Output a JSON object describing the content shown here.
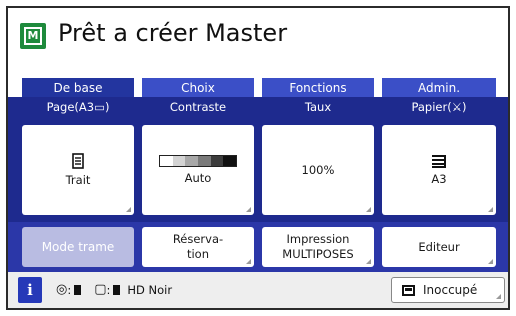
{
  "header": {
    "title": "Prêt a créer Master",
    "icon": "master-icon",
    "icon_letter": "M",
    "icon_color": "#1e8a3c"
  },
  "tabs": [
    {
      "label": "De base",
      "active": true
    },
    {
      "label": "Choix",
      "active": false
    },
    {
      "label": "Fonctions",
      "active": false
    },
    {
      "label": "Admin.",
      "active": false
    }
  ],
  "columns": {
    "page": {
      "label": "Page(A3▭)",
      "icon": "document-icon",
      "value": "Trait"
    },
    "contrast": {
      "label": "Contraste",
      "icon": "contrast-scale-icon",
      "value": "Auto"
    },
    "rate": {
      "label": "Taux",
      "value": "100%"
    },
    "paper": {
      "label": "Papier(⚔)",
      "icon": "paper-stack-icon",
      "value": "A3"
    }
  },
  "actions": {
    "mode_trame": "Mode trame",
    "reservation": "Réserva-\ntion",
    "impression": "Impression\nMULTIPOSES",
    "editeur": "Editeur"
  },
  "status": {
    "info_symbol": "i",
    "ink_text": "HD Noir",
    "state_label": "Inoccupé"
  },
  "colors": {
    "tab_active": "#23359f",
    "tab": "#3b4fc7",
    "panel": "#1e2a8e",
    "action_row": "#2b37a8",
    "accent_green": "#1e8a3c"
  }
}
